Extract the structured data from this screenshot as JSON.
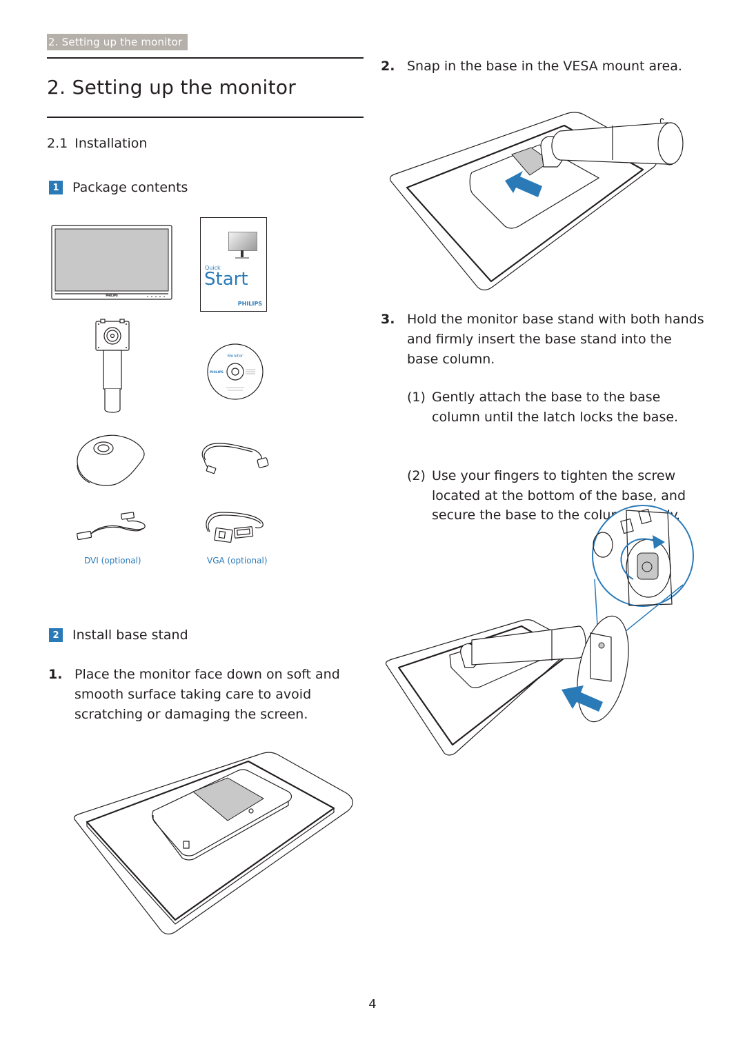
{
  "header": {
    "section_tab": "2. Setting up the monitor"
  },
  "title": "2.  Setting up the monitor",
  "section": {
    "number": "2.1",
    "title": "Installation"
  },
  "package_contents": {
    "badge": "1",
    "title": "Package contents",
    "quick_start": {
      "line1": "Quick",
      "line2": "Start",
      "brand": "PHILIPS"
    },
    "cd": {
      "title": "Monitor",
      "brand": "PHILIPS"
    },
    "monitor_brand": "PHILIPS",
    "captions": {
      "dvi": "DVI (optional)",
      "vga": "VGA (optional)"
    }
  },
  "install_base": {
    "badge": "2",
    "title": "Install base stand",
    "steps": [
      {
        "number": "1.",
        "text": "Place the monitor face down on soft and smooth surface taking care to avoid scratching or damaging the screen."
      },
      {
        "number": "2.",
        "text": "Snap in the base in the VESA mount area."
      },
      {
        "number": "3.",
        "text": "Hold the monitor base stand with both hands and firmly insert the base stand into the base column."
      }
    ],
    "sub_steps": [
      {
        "number": "(1)",
        "text": "Gently attach the base to the base column until the latch locks the base."
      },
      {
        "number": "(2)",
        "text": "Use your fingers to tighten the screw located at the bottom of the base, and secure the base to the column tightly."
      }
    ]
  },
  "page_number": "4",
  "colors": {
    "accent_blue": "#2a7ab8",
    "tab_gray": "#b5b0aa",
    "text": "#231f20"
  }
}
